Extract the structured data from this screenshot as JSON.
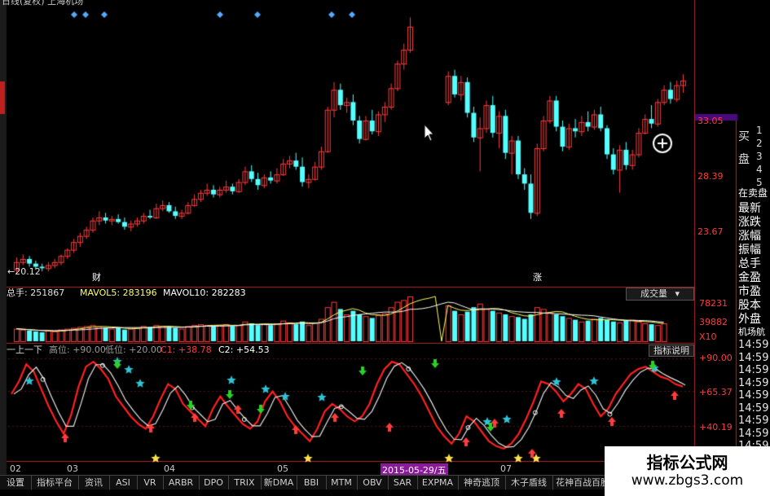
{
  "top": {
    "title": "日线(复权) 上海机场"
  },
  "main": {
    "label_low": "←20.12",
    "marker_cai": "财",
    "marker_zhang": "涨",
    "axis": [
      "33.05",
      "28.39",
      "23.67"
    ]
  },
  "volume": {
    "label_total": "总手: 251867",
    "label_ma5": "MAVOL5: 283196",
    "label_ma10": "MAVOL10: 282283",
    "dropdown": "成交量",
    "axis": [
      "78231",
      "39882",
      "X10"
    ]
  },
  "indicator": {
    "name": "一上一下",
    "label_high": "高位: +90.00",
    "label_low": "低位: +20.00",
    "label_c1": "C1: +38.78",
    "label_c2": "C2: +54.53",
    "button": "指标说明",
    "axis": [
      "+90.00",
      "+65.37",
      "+40.19"
    ]
  },
  "dates": {
    "items": [
      "02",
      "03",
      "04",
      "05",
      "07"
    ],
    "highlight": "2015-05-29/五"
  },
  "tabs": [
    "设置",
    "指标平台",
    "资讯",
    "ASI",
    "VR",
    "ARBR",
    "DPO",
    "TRIX",
    "新DMA",
    "BBI",
    "MTM",
    "OBV",
    "SAR",
    "EXPMA",
    "神奇逃顶",
    "木子盾线",
    "花神百战百胜"
  ],
  "side": {
    "buy_label": "买",
    "sell_label": "盘",
    "nums": [
      "1",
      "2",
      "3",
      "4",
      "5"
    ],
    "items": [
      "在卖盘",
      "最新",
      "涨跌",
      "涨幅",
      "振幅",
      "总手",
      "金盈",
      "市盈",
      "股本",
      "外盘",
      "机场航"
    ],
    "times": [
      "14:59",
      "14:59",
      "14:59",
      "14:59",
      "14:59",
      "14:59",
      "14:59",
      "14:59",
      "14:59",
      "14:59",
      "14:59"
    ]
  },
  "watermark": {
    "title": "指标公式网",
    "url": "www.zbgs3.com"
  },
  "colors": {
    "up": "#ff3c3c",
    "down": "#54ffff",
    "star": "#ffe14a",
    "green": "#28d228",
    "ma1": "#ff2020",
    "ma2": "#e6e6e6"
  },
  "chart_data": {
    "type": "candlestick",
    "ylim": [
      19.5,
      37.5
    ],
    "candles": [
      [
        20.6,
        21.4,
        20.4,
        21.1
      ],
      [
        21.1,
        21.6,
        20.9,
        21.3
      ],
      [
        21.3,
        21.5,
        20.8,
        21.0
      ],
      [
        21.0,
        21.2,
        20.6,
        20.8
      ],
      [
        20.8,
        21.0,
        20.5,
        20.7
      ],
      [
        20.7,
        21.1,
        20.5,
        20.9
      ],
      [
        20.9,
        21.3,
        20.7,
        21.1
      ],
      [
        21.1,
        21.6,
        20.9,
        21.5
      ],
      [
        21.5,
        22.0,
        21.3,
        21.9
      ],
      [
        21.9,
        22.6,
        21.7,
        22.4
      ],
      [
        22.4,
        23.0,
        22.1,
        22.8
      ],
      [
        22.8,
        23.4,
        22.6,
        23.2
      ],
      [
        23.2,
        24.0,
        23.0,
        23.8
      ],
      [
        23.8,
        24.4,
        23.5,
        24.0
      ],
      [
        24.0,
        24.3,
        23.6,
        23.8
      ],
      [
        23.8,
        24.1,
        23.5,
        23.9
      ],
      [
        23.9,
        24.2,
        23.6,
        23.7
      ],
      [
        23.7,
        24.0,
        23.2,
        23.4
      ],
      [
        23.4,
        23.8,
        23.1,
        23.6
      ],
      [
        23.6,
        24.0,
        23.4,
        23.8
      ],
      [
        23.8,
        24.3,
        23.6,
        24.1
      ],
      [
        24.1,
        24.5,
        23.9,
        24.0
      ],
      [
        24.0,
        24.9,
        23.9,
        24.6
      ],
      [
        24.6,
        25.1,
        24.4,
        24.8
      ],
      [
        24.8,
        25.0,
        24.3,
        24.4
      ],
      [
        24.4,
        24.7,
        23.9,
        24.1
      ],
      [
        24.1,
        24.5,
        23.9,
        24.3
      ],
      [
        24.3,
        25.0,
        24.2,
        24.8
      ],
      [
        24.8,
        25.5,
        24.7,
        25.2
      ],
      [
        25.2,
        25.8,
        25.0,
        25.6
      ],
      [
        25.6,
        26.2,
        25.4,
        25.8
      ],
      [
        25.8,
        26.1,
        25.3,
        25.5
      ],
      [
        25.5,
        26.0,
        25.3,
        25.8
      ],
      [
        25.8,
        26.4,
        25.6,
        26.0
      ],
      [
        26.0,
        26.2,
        25.5,
        25.7
      ],
      [
        25.7,
        26.5,
        25.6,
        26.3
      ],
      [
        26.3,
        27.3,
        26.1,
        27.0
      ],
      [
        27.0,
        27.4,
        26.3,
        26.5
      ],
      [
        26.5,
        26.9,
        25.8,
        26.1
      ],
      [
        26.1,
        26.8,
        25.9,
        26.6
      ],
      [
        26.6,
        27.0,
        26.2,
        26.4
      ],
      [
        26.4,
        27.2,
        26.2,
        26.8
      ],
      [
        26.8,
        27.8,
        26.7,
        27.5
      ],
      [
        27.5,
        28.0,
        27.2,
        27.7
      ],
      [
        27.7,
        28.2,
        27.1,
        27.3
      ],
      [
        27.3,
        27.9,
        26.0,
        26.3
      ],
      [
        26.3,
        26.8,
        25.9,
        26.5
      ],
      [
        26.5,
        27.6,
        26.4,
        27.3
      ],
      [
        27.3,
        28.6,
        27.1,
        28.3
      ],
      [
        28.3,
        31.2,
        28.2,
        31.0
      ],
      [
        31.0,
        32.8,
        30.5,
        32.3
      ],
      [
        32.3,
        32.7,
        31.0,
        31.3
      ],
      [
        31.3,
        31.8,
        30.8,
        31.5
      ],
      [
        31.5,
        32.0,
        30.0,
        30.3
      ],
      [
        30.3,
        30.6,
        28.8,
        29.1
      ],
      [
        29.1,
        30.6,
        29.0,
        30.3
      ],
      [
        30.3,
        31.0,
        29.4,
        29.6
      ],
      [
        29.6,
        30.9,
        29.3,
        30.7
      ],
      [
        30.7,
        31.5,
        30.2,
        31.2
      ],
      [
        31.2,
        32.7,
        31.0,
        32.4
      ],
      [
        32.4,
        34.2,
        32.2,
        34.0
      ],
      [
        34.0,
        35.3,
        33.6,
        34.9
      ],
      [
        34.9,
        37.0,
        34.7,
        36.4
      ],
      [
        null,
        null,
        null,
        null
      ],
      [
        null,
        null,
        null,
        null
      ],
      [
        null,
        null,
        null,
        null
      ],
      [
        null,
        null,
        null,
        null
      ],
      [
        null,
        null,
        null,
        null
      ],
      [
        31.5,
        33.5,
        31.3,
        33.2
      ],
      [
        33.2,
        33.6,
        31.8,
        32.0
      ],
      [
        32.0,
        33.2,
        31.6,
        32.8
      ],
      [
        32.8,
        33.1,
        30.5,
        30.8
      ],
      [
        30.8,
        31.2,
        28.9,
        29.2
      ],
      [
        29.2,
        30.5,
        27.0,
        29.8
      ],
      [
        29.8,
        31.6,
        29.5,
        31.3
      ],
      [
        31.3,
        31.9,
        29.2,
        29.5
      ],
      [
        29.5,
        30.9,
        28.5,
        30.6
      ],
      [
        30.6,
        31.0,
        27.8,
        28.2
      ],
      [
        28.2,
        29.3,
        26.8,
        29.0
      ],
      [
        29.0,
        29.3,
        26.5,
        26.8
      ],
      [
        26.8,
        27.2,
        25.8,
        26.2
      ],
      [
        26.2,
        26.8,
        23.9,
        24.3
      ],
      [
        24.3,
        28.8,
        24.1,
        28.5
      ],
      [
        28.5,
        30.6,
        28.3,
        30.3
      ],
      [
        30.3,
        31.9,
        30.1,
        31.6
      ],
      [
        31.6,
        31.9,
        29.6,
        29.9
      ],
      [
        29.9,
        30.3,
        28.3,
        28.6
      ],
      [
        28.6,
        30.1,
        28.4,
        29.8
      ],
      [
        29.8,
        30.4,
        29.2,
        29.6
      ],
      [
        29.6,
        30.6,
        29.3,
        30.2
      ],
      [
        30.2,
        30.9,
        29.6,
        29.9
      ],
      [
        29.9,
        31.0,
        29.7,
        30.7
      ],
      [
        30.7,
        31.2,
        29.6,
        29.8
      ],
      [
        29.8,
        30.0,
        27.8,
        28.1
      ],
      [
        28.1,
        28.5,
        26.8,
        27.1
      ],
      [
        27.1,
        28.7,
        25.6,
        28.4
      ],
      [
        28.4,
        28.9,
        27.1,
        27.4
      ],
      [
        27.4,
        28.4,
        27.1,
        28.1
      ],
      [
        28.1,
        29.8,
        27.9,
        29.5
      ],
      [
        29.5,
        30.7,
        29.4,
        30.4
      ],
      [
        30.4,
        31.3,
        29.8,
        30.1
      ],
      [
        30.1,
        31.7,
        29.9,
        31.5
      ],
      [
        31.5,
        32.6,
        31.3,
        32.3
      ],
      [
        32.3,
        32.8,
        31.4,
        31.7
      ],
      [
        31.7,
        32.9,
        31.5,
        32.6
      ],
      [
        32.6,
        33.3,
        32.1,
        32.9
      ]
    ],
    "volume": [
      14,
      13,
      12,
      11,
      10,
      12,
      11,
      13,
      14,
      15,
      16,
      17,
      18,
      16,
      15,
      14,
      15,
      13,
      14,
      15,
      17,
      16,
      18,
      17,
      16,
      15,
      14,
      17,
      18,
      19,
      18,
      17,
      18,
      19,
      17,
      18,
      22,
      20,
      18,
      19,
      18,
      20,
      23,
      21,
      19,
      22,
      18,
      21,
      25,
      38,
      44,
      36,
      30,
      34,
      30,
      28,
      26,
      29,
      31,
      38,
      44,
      46,
      50,
      0,
      0,
      0,
      0,
      0,
      40,
      34,
      30,
      33,
      38,
      42,
      36,
      34,
      32,
      30,
      28,
      27,
      25,
      30,
      38,
      36,
      32,
      30,
      28,
      26,
      24,
      22,
      23,
      25,
      26,
      24,
      22,
      21,
      23,
      24,
      22,
      20,
      19,
      18,
      20
    ],
    "indicator_red": [
      62,
      72,
      86,
      80,
      66,
      52,
      40,
      30,
      45,
      68,
      84,
      88,
      82,
      74,
      60,
      52,
      44,
      38,
      34,
      44,
      58,
      70,
      66,
      54,
      48,
      42,
      36,
      50,
      60,
      52,
      45,
      38,
      34,
      40,
      56,
      64,
      56,
      44,
      36,
      30,
      24,
      34,
      48,
      54,
      50,
      44,
      40,
      44,
      54,
      70,
      82,
      88,
      86,
      78,
      70,
      60,
      48,
      36,
      28,
      22,
      30,
      44,
      40,
      32,
      24,
      20,
      18,
      22,
      30,
      42,
      56,
      72,
      70,
      64,
      56,
      62,
      70,
      66,
      54,
      44,
      50,
      62,
      70,
      78,
      82,
      84,
      80,
      76,
      74,
      70,
      68
    ]
  }
}
